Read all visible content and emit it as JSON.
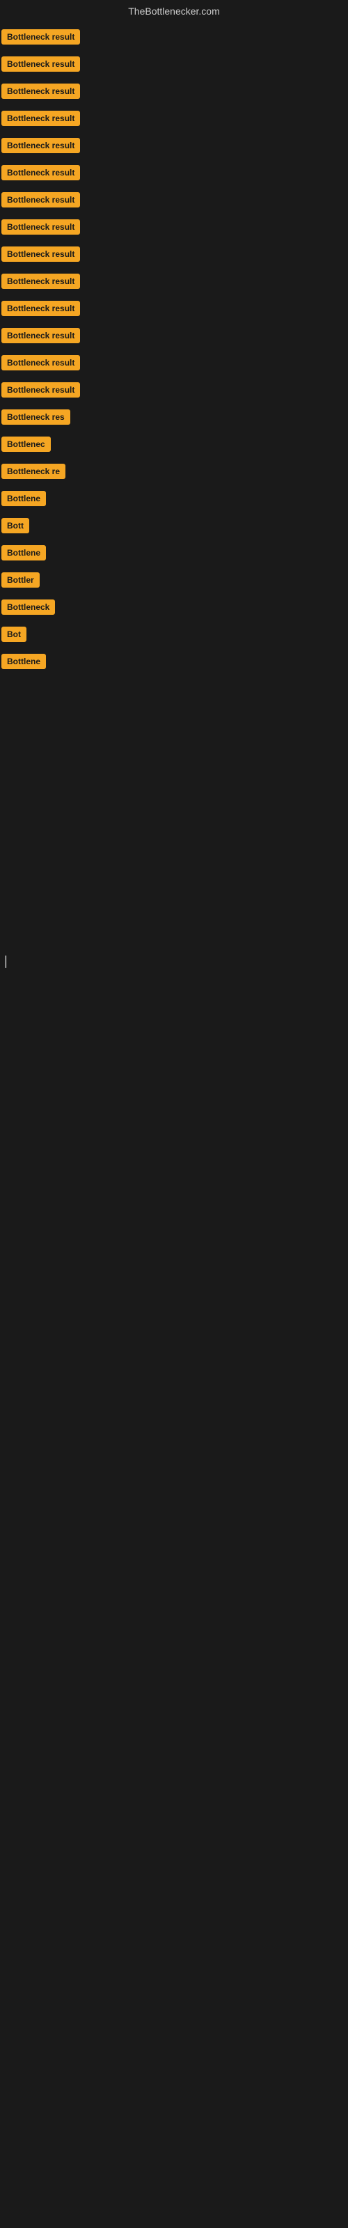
{
  "header": {
    "title": "TheBottlenecker.com"
  },
  "colors": {
    "badge_bg": "#f5a623",
    "bg": "#1a1a1a",
    "text": "#cccccc"
  },
  "items": [
    {
      "id": 1,
      "label": "Bottleneck result",
      "width": 130
    },
    {
      "id": 2,
      "label": "Bottleneck result",
      "width": 130
    },
    {
      "id": 3,
      "label": "Bottleneck result",
      "width": 130
    },
    {
      "id": 4,
      "label": "Bottleneck result",
      "width": 130
    },
    {
      "id": 5,
      "label": "Bottleneck result",
      "width": 130
    },
    {
      "id": 6,
      "label": "Bottleneck result",
      "width": 130
    },
    {
      "id": 7,
      "label": "Bottleneck result",
      "width": 130
    },
    {
      "id": 8,
      "label": "Bottleneck result",
      "width": 130
    },
    {
      "id": 9,
      "label": "Bottleneck result",
      "width": 130
    },
    {
      "id": 10,
      "label": "Bottleneck result",
      "width": 130
    },
    {
      "id": 11,
      "label": "Bottleneck result",
      "width": 130
    },
    {
      "id": 12,
      "label": "Bottleneck result",
      "width": 130
    },
    {
      "id": 13,
      "label": "Bottleneck result",
      "width": 130
    },
    {
      "id": 14,
      "label": "Bottleneck result",
      "width": 130
    },
    {
      "id": 15,
      "label": "Bottleneck res",
      "width": 110
    },
    {
      "id": 16,
      "label": "Bottlenec",
      "width": 80
    },
    {
      "id": 17,
      "label": "Bottleneck re",
      "width": 100
    },
    {
      "id": 18,
      "label": "Bottlene",
      "width": 72
    },
    {
      "id": 19,
      "label": "Bott",
      "width": 46
    },
    {
      "id": 20,
      "label": "Bottlene",
      "width": 72
    },
    {
      "id": 21,
      "label": "Bottler",
      "width": 60
    },
    {
      "id": 22,
      "label": "Bottleneck",
      "width": 86
    },
    {
      "id": 23,
      "label": "Bot",
      "width": 38
    },
    {
      "id": 24,
      "label": "Bottlene",
      "width": 72
    }
  ]
}
